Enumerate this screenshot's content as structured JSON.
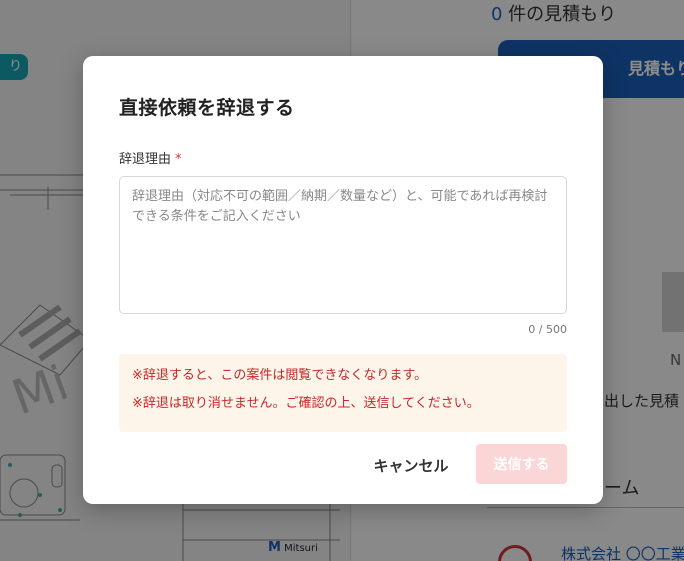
{
  "background": {
    "tag_label": "り",
    "quote_count": "0",
    "quote_count_suffix": " 件の見積もり",
    "quote_button_label": "見積もり",
    "nd_text": "N",
    "side_text_1": "出した見積",
    "side_text_2": "ーム",
    "company_name": "株式会社 〇〇工業",
    "logo_text": "Mitsuri"
  },
  "modal": {
    "title": "直接依頼を辞退する",
    "field": {
      "label": "辞退理由",
      "required_mark": "*",
      "value": "",
      "placeholder": "辞退理由（対応不可の範囲／納期／数量など）と、可能であれば再検討できる条件をご記入ください",
      "counter": "0 / 500"
    },
    "warnings": [
      "※辞退すると、この案件は閲覧できなくなります。",
      "※辞退は取り消せません。ご確認の上、送信してください。"
    ],
    "buttons": {
      "cancel_label": "キャンセル",
      "submit_label": "送信する"
    }
  },
  "colors": {
    "accent_blue": "#1b5fb8",
    "warning_text": "#c62828",
    "warning_bg": "#fdf4ea",
    "submit_disabled_bg": "#fbd6d6",
    "required_mark": "#d93025"
  }
}
